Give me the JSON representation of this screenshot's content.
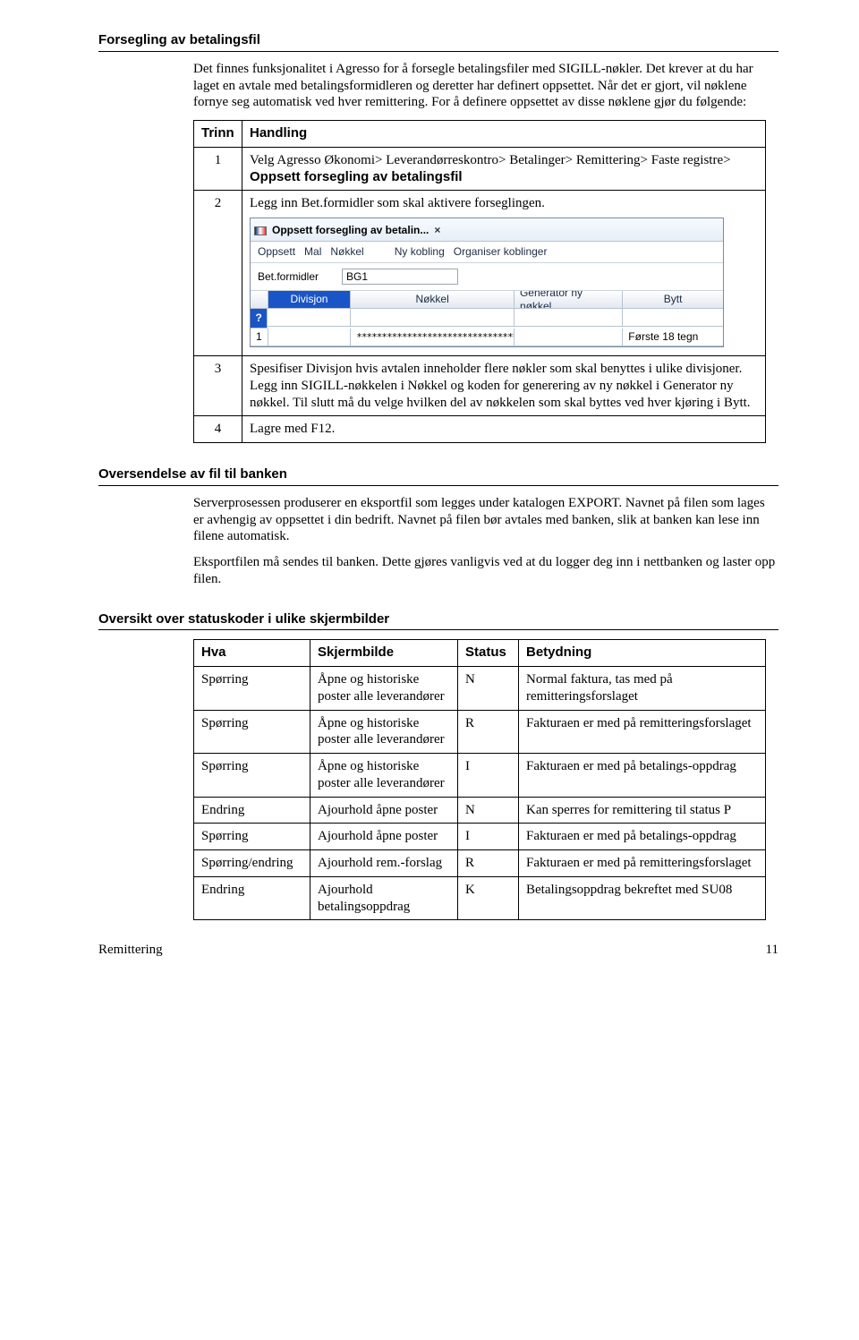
{
  "h1": "Forsegling av betalingsfil",
  "p1": "Det finnes funksjonalitet i Agresso for å forsegle betalingsfiler med SIGILL-nøkler. Det krever at du har laget en avtale med betalingsformidleren og deretter har definert oppsettet. Når det er gjort, vil nøklene fornye seg automatisk ved hver remittering. For å definere oppsettet av disse nøklene gjør du følgende:",
  "t1": {
    "head": [
      "Trinn",
      "Handling"
    ],
    "rows": [
      {
        "n": "1",
        "text_a": "Velg Agresso Økonomi> Leverandørreskontro> Betalinger> Remittering> Faste registre> ",
        "text_b": "Oppsett forsegling av betalingsfil"
      },
      {
        "n": "2",
        "text_a": "Legg inn Bet.formidler som skal aktivere forseglingen.",
        "text_b": ""
      }
    ]
  },
  "fig": {
    "title": "Oppsett forsegling av betalin...",
    "menu": [
      "Oppsett",
      "Mal",
      "Nøkkel"
    ],
    "menu2": [
      "Ny kobling",
      "Organiser koblinger"
    ],
    "field_label": "Bet.formidler",
    "field_value": "BG1",
    "cols": [
      "Divisjon",
      "Nøkkel",
      "Generator ny nøkkel",
      "Bytt"
    ],
    "row_q": "?",
    "row_num": "1",
    "stars": "********************************",
    "bytt": "Første 18 tegn"
  },
  "t1b": {
    "rows": [
      {
        "n": "3",
        "text": "Spesifiser Divisjon hvis avtalen inneholder flere nøkler som skal benyttes i ulike divisjoner. Legg inn SIGILL-nøkkelen i Nøkkel og koden for generering av ny nøkkel i Generator ny nøkkel. Til slutt må du velge hvilken del av nøkkelen som skal byttes ved hver kjøring i Bytt."
      },
      {
        "n": "4",
        "text": "Lagre med F12."
      }
    ]
  },
  "h2": "Oversendelse av fil til banken",
  "p2a": "Serverprosessen produserer en eksportfil som legges under katalogen EXPORT. Navnet på filen som lages er avhengig av oppsettet i din bedrift. Navnet på filen bør avtales med banken, slik at banken kan lese inn filene automatisk.",
  "p2b": "Eksportfilen må sendes til banken. Dette gjøres vanligvis ved at du logger deg inn i nettbanken og laster opp filen.",
  "h3": "Oversikt over statuskoder i ulike skjermbilder",
  "t2": {
    "head": [
      "Hva",
      "Skjermbilde",
      "Status",
      "Betydning"
    ],
    "rows": [
      [
        "Spørring",
        "Åpne og historiske poster alle leverandører",
        "N",
        "Normal faktura, tas med på remitteringsforslaget"
      ],
      [
        "Spørring",
        "Åpne og historiske poster alle leverandører",
        "R",
        "Fakturaen er med på remitteringsforslaget"
      ],
      [
        "Spørring",
        "Åpne og historiske poster alle leverandører",
        "I",
        "Fakturaen er med på betalings-oppdrag"
      ],
      [
        "Endring",
        "Ajourhold åpne poster",
        "N",
        "Kan sperres for remittering til status P"
      ],
      [
        "Spørring",
        "Ajourhold åpne poster",
        "I",
        "Fakturaen er med på betalings-oppdrag"
      ],
      [
        "Spørring/endring",
        "Ajourhold rem.-forslag",
        "R",
        "Fakturaen er med på remitteringsforslaget"
      ],
      [
        "Endring",
        "Ajourhold betalingsoppdrag",
        "K",
        "Betalingsoppdrag bekreftet med SU08"
      ]
    ]
  },
  "footer_left": "Remittering",
  "footer_right": "11"
}
